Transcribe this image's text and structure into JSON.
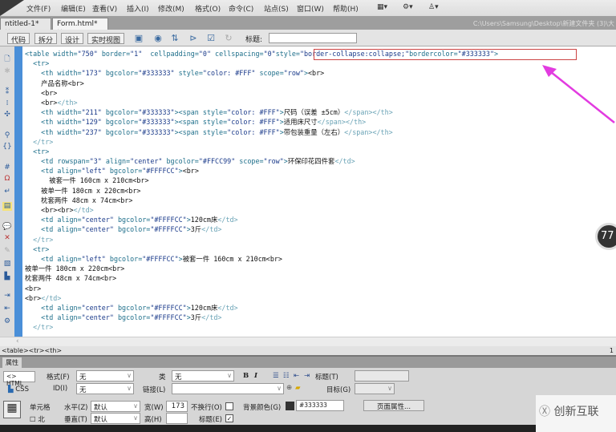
{
  "menu": [
    "文件(F)",
    "编辑(E)",
    "查看(V)",
    "插入(I)",
    "修改(M)",
    "格式(O)",
    "命令(C)",
    "站点(S)",
    "窗口(W)",
    "帮助(H)"
  ],
  "tabs": [
    {
      "label": "ntitled-1*",
      "close": "×"
    },
    {
      "label": "Form.html*",
      "close": "×"
    }
  ],
  "file_path": "C:\\Users\\Samsung\\Desktop\\新建文件夹 (3)\\大",
  "view_buttons": [
    "代码",
    "拆分",
    "设计",
    "实时视图"
  ],
  "title_label": "标题:",
  "code_lines": [
    "<table width=\"750\" border=\"1\"  cellpadding=\"0\" cellspacing=\"0\"style=\"border-collapse:collapse;\"bordercolor=\"#333333\">",
    "  <tr>",
    "    <th width=\"173\" bgcolor=\"#333333\" style=\"color: #FFF\" scope=\"row\"><br>",
    "    产品名称<br>",
    "    <br>",
    "    <br></th>",
    "    <th width=\"211\" bgcolor=\"#333333\"><span style=\"color: #FFF\">尺码（误差 ±5cm）</span></th>",
    "    <th width=\"129\" bgcolor=\"#333333\"><span style=\"color: #FFF\">适用床尺寸</span></th>",
    "    <th width=\"237\" bgcolor=\"#333333\"><span style=\"color: #FFF\">带包装重量（左右）</span></th>",
    "  </tr>",
    "  <tr>",
    "    <td rowspan=\"3\" align=\"center\" bgcolor=\"#FFCC99\" scope=\"row\">环保印花四件套</td>",
    "    <td align=\"left\" bgcolor=\"#FFFFCC\"><br>",
    "      被套一件 160cm x 210cm<br>",
    "    被单一件 180cm x 220cm<br>",
    "    枕套两件 48cm x 74cm<br>",
    "    <br><br></td>",
    "    <td align=\"center\" bgcolor=\"#FFFFCC\">120cm床</td>",
    "    <td align=\"center\" bgcolor=\"#FFFFCC\">3斤</td>",
    "  </tr>",
    "  <tr>",
    "    <td align=\"left\" bgcolor=\"#FFFFCC\">被套一件 160cm x 210cm<br>",
    "被单一件 180cm x 220cm<br>",
    "枕套两件 48cm x 74cm<br>",
    "<br>",
    "<br></td>",
    "    <td align=\"center\" bgcolor=\"#FFFFCC\">120cm床</td>",
    "    <td align=\"center\" bgcolor=\"#FFFFCC\">3斤</td>",
    "  </tr>"
  ],
  "status_path": "<table><tr><th>",
  "status_right": "1",
  "props": {
    "tab": "属性",
    "html_btn": "<> HTML",
    "css_btn": "CSS",
    "format_label": "格式(F)",
    "format_value": "无",
    "id_label": "ID(I)",
    "id_value": "无",
    "class_label": "类",
    "class_value": "无",
    "link_label": "链接(L)",
    "link_value": "",
    "bold": "B",
    "italic": "I",
    "title_label": "标题(T)",
    "target_label": "目标(G)",
    "cell_label": "单元格",
    "cell_sub": "北",
    "horz_label": "水平(Z)",
    "horz_value": "默认",
    "vert_label": "垂直(T)",
    "vert_value": "默认",
    "width_label": "宽(W)",
    "width_value": "173",
    "height_label": "高(H)",
    "height_value": "",
    "nowrap_label": "不换行(O)",
    "header_label": "标题(E)",
    "bg_label": "背景颜色(G)",
    "bg_value": "#333333",
    "page_props": "页面属性..."
  },
  "logo": "创新互联",
  "badge": "77"
}
